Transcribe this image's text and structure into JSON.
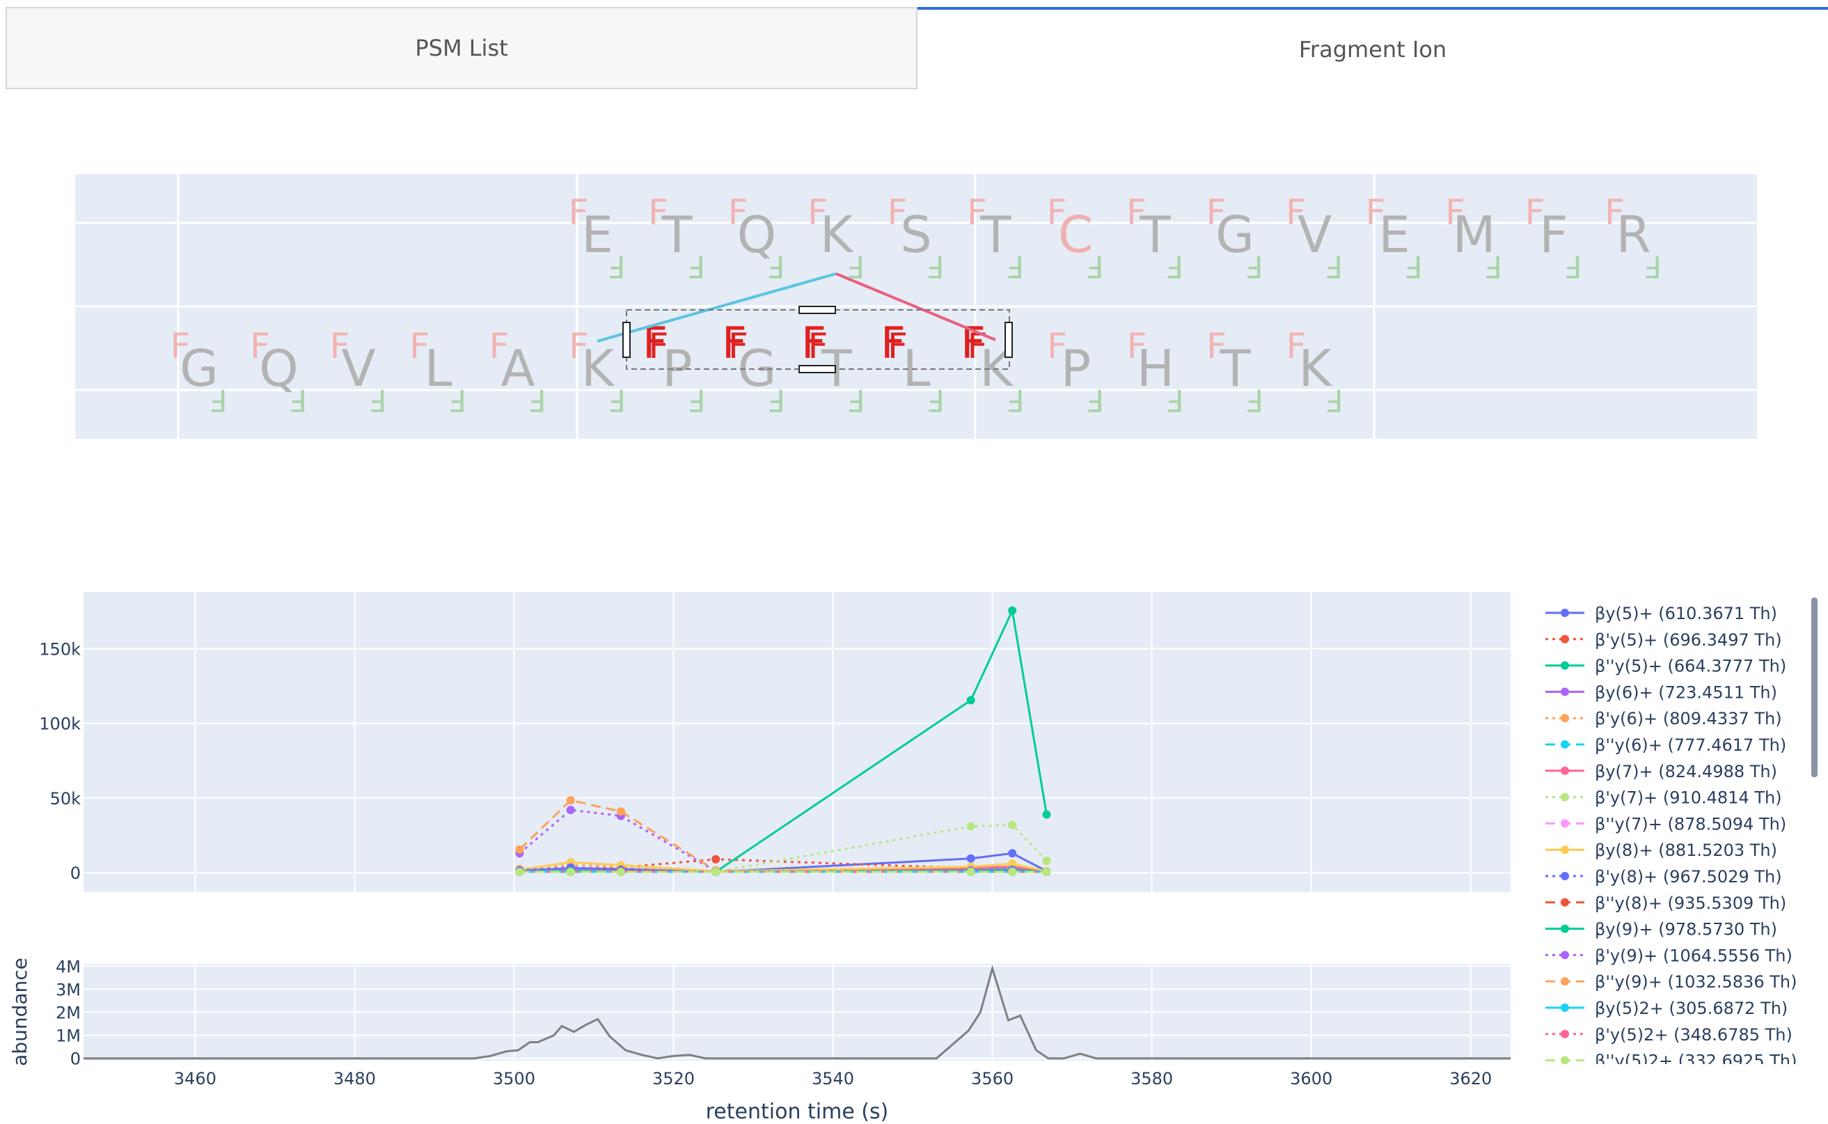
{
  "tabs": {
    "psm_list": "PSM List",
    "fragment_ion": "Fragment Ion"
  },
  "sequence_map": {
    "peptide_alpha": [
      "E",
      "T",
      "Q",
      "K",
      "S",
      "T",
      "C",
      "T",
      "G",
      "V",
      "E",
      "M",
      "F",
      "R"
    ],
    "peptide_beta": [
      "G",
      "Q",
      "V",
      "L",
      "A",
      "K",
      "P",
      "G",
      "T",
      "L",
      "K",
      "P",
      "H",
      "T",
      "K"
    ],
    "highlighted_residues": {
      "alpha": [
        6
      ],
      "beta": []
    },
    "fragment_marker": "F",
    "highlight_color": "#e02020",
    "residue_color": "#b3b3b3",
    "crosslink_alpha_colour": "#e8607e",
    "crosslink_beta_colour": "#5ac4e0"
  },
  "chart_data": [
    {
      "type": "line",
      "x_axis": {
        "range": [
          3446,
          3625
        ],
        "ticks": [
          3460,
          3480,
          3500,
          3520,
          3540,
          3560,
          3580,
          3600,
          3620
        ]
      },
      "y_axis": {
        "range": [
          -13000,
          188000
        ],
        "ticks": [
          0,
          50000,
          100000,
          150000
        ],
        "tick_labels": [
          "0",
          "50k",
          "100k",
          "150k"
        ]
      },
      "x": [
        3500.7,
        3507.1,
        3513.4,
        3525.3,
        3557.3,
        3562.5,
        3566.8
      ],
      "series": [
        {
          "name": "βy(5)+ (610.3671 Th)",
          "color": "#636efa",
          "dash": "solid",
          "values": [
            1500,
            3000,
            2500,
            500,
            9500,
            13000,
            1000
          ]
        },
        {
          "name": "β'y(5)+ (696.3497 Th)",
          "color": "#ef553b",
          "dash": "dot",
          "values": [
            2000,
            2500,
            3500,
            9000,
            3000,
            3500,
            500
          ]
        },
        {
          "name": "β''y(5)+ (664.3777 Th)",
          "color": "#00cc96",
          "dash": "solid",
          "values": [
            500,
            500,
            500,
            500,
            115500,
            175500,
            39000
          ]
        },
        {
          "name": "βy(6)+ (723.4511 Th)",
          "color": "#ab63fa",
          "dash": "solid",
          "values": [
            1000,
            2000,
            1500,
            500,
            2500,
            3500,
            500
          ]
        },
        {
          "name": "β'y(6)+ (809.4337 Th)",
          "color": "#ffa15a",
          "dash": "dot",
          "values": [
            2500,
            5000,
            4000,
            500,
            2000,
            3000,
            500
          ]
        },
        {
          "name": "β''y(6)+ (777.4617 Th)",
          "color": "#19d3f3",
          "dash": "dash",
          "values": [
            500,
            1500,
            1000,
            500,
            1000,
            1500,
            500
          ]
        },
        {
          "name": "βy(7)+ (824.4988 Th)",
          "color": "#ff6692",
          "dash": "solid",
          "values": [
            500,
            1000,
            1000,
            500,
            3000,
            4000,
            500
          ]
        },
        {
          "name": "β'y(7)+ (910.4814 Th)",
          "color": "#b6e880",
          "dash": "dot",
          "values": [
            500,
            1000,
            1000,
            500,
            31000,
            32000,
            8000
          ]
        },
        {
          "name": "β''y(7)+ (878.5094 Th)",
          "color": "#ff97ff",
          "dash": "dash",
          "values": [
            500,
            500,
            500,
            500,
            1000,
            1500,
            500
          ]
        },
        {
          "name": "βy(8)+ (881.5203 Th)",
          "color": "#fecb52",
          "dash": "solid",
          "values": [
            2000,
            7000,
            5000,
            1000,
            4000,
            6000,
            1000
          ]
        },
        {
          "name": "β'y(8)+ (967.5029 Th)",
          "color": "#636efa",
          "dash": "dot",
          "values": [
            1500,
            3500,
            2000,
            500,
            1500,
            2000,
            500
          ]
        },
        {
          "name": "β''y(8)+ (935.5309 Th)",
          "color": "#ef553b",
          "dash": "dash",
          "values": [
            500,
            1000,
            1000,
            500,
            1000,
            1000,
            500
          ]
        },
        {
          "name": "βy(9)+ (978.5730 Th)",
          "color": "#00cc96",
          "dash": "solid",
          "values": [
            500,
            1000,
            500,
            500,
            1500,
            2000,
            500
          ]
        },
        {
          "name": "β'y(9)+ (1064.5556 Th)",
          "color": "#ab63fa",
          "dash": "dot",
          "values": [
            13000,
            42000,
            38000,
            1000,
            1500,
            1500,
            500
          ]
        },
        {
          "name": "β''y(9)+ (1032.5836 Th)",
          "color": "#ffa15a",
          "dash": "dash",
          "values": [
            15500,
            48500,
            41000,
            1500,
            500,
            500,
            500
          ]
        },
        {
          "name": "βy(5)2+ (305.6872 Th)",
          "color": "#19d3f3",
          "dash": "solid",
          "values": [
            500,
            500,
            500,
            500,
            500,
            500,
            500
          ]
        },
        {
          "name": "β'y(5)2+ (348.6785 Th)",
          "color": "#ff6692",
          "dash": "dot",
          "values": [
            500,
            500,
            500,
            500,
            500,
            500,
            500
          ]
        },
        {
          "name": "β''y(5)2+ (332.6925 Th)",
          "color": "#b6e880",
          "dash": "dash",
          "values": [
            500,
            500,
            500,
            500,
            500,
            500,
            500
          ]
        }
      ]
    },
    {
      "type": "line",
      "ylabel": "abundance",
      "xlabel": "retention time (s)",
      "x_axis": {
        "range": [
          3446,
          3625
        ],
        "ticks": [
          3460,
          3480,
          3500,
          3520,
          3540,
          3560,
          3580,
          3600,
          3620
        ],
        "tick_labels": [
          "3460",
          "3480",
          "3500",
          "3520",
          "3540",
          "3560",
          "3580",
          "3600",
          "3620"
        ]
      },
      "y_axis": {
        "range": [
          -100000,
          4100000
        ],
        "ticks": [
          0,
          1000000,
          2000000,
          3000000,
          4000000
        ],
        "tick_labels": [
          "0",
          "1M",
          "2M",
          "3M",
          "4M"
        ]
      },
      "series": [
        {
          "color": "#808080",
          "x": [
            3446,
            3495,
            3497,
            3499,
            3500.5,
            3502,
            3503,
            3505,
            3506,
            3507.5,
            3509,
            3510.5,
            3512,
            3514,
            3516,
            3518,
            3520,
            3522,
            3524,
            3526,
            3528,
            3530,
            3553,
            3555,
            3557,
            3558.5,
            3560,
            3562,
            3563.5,
            3565.5,
            3567,
            3569,
            3571,
            3573,
            3625
          ],
          "values": [
            0,
            0,
            100000,
            300000,
            350000,
            700000,
            700000,
            1000000,
            1400000,
            1150000,
            1450000,
            1700000,
            950000,
            350000,
            150000,
            0,
            100000,
            150000,
            0,
            0,
            0,
            0,
            0,
            600000,
            1200000,
            2000000,
            3900000,
            1650000,
            1850000,
            350000,
            0,
            0,
            200000,
            0,
            0
          ]
        }
      ]
    }
  ]
}
